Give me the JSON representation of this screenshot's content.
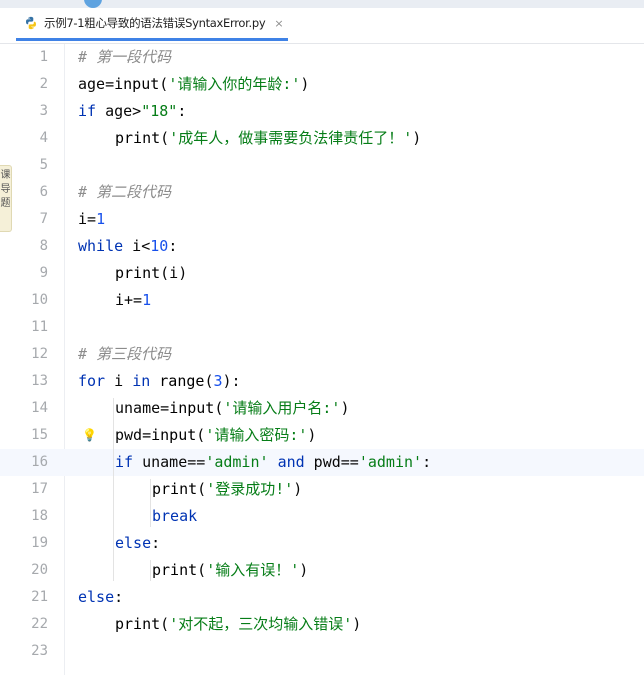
{
  "tab": {
    "title": "示例7-1粗心导致的语法错误SyntaxError.py",
    "close_glyph": "×",
    "icon": "python-file-icon"
  },
  "side_panel": {
    "chars": [
      "课",
      "导",
      "题"
    ]
  },
  "editor": {
    "current_line": 16,
    "lines": [
      {
        "n": 1,
        "indent": 0,
        "tokens": [
          {
            "t": "# 第一段代码",
            "c": "cmt"
          }
        ]
      },
      {
        "n": 2,
        "indent": 0,
        "tokens": [
          {
            "t": "age=",
            "c": ""
          },
          {
            "t": "input",
            "c": "fn"
          },
          {
            "t": "(",
            "c": ""
          },
          {
            "t": "'请输入你的年龄:'",
            "c": "str"
          },
          {
            "t": ")",
            "c": ""
          }
        ]
      },
      {
        "n": 3,
        "indent": 0,
        "tokens": [
          {
            "t": "if",
            "c": "kw"
          },
          {
            "t": " age>",
            "c": ""
          },
          {
            "t": "\"18\"",
            "c": "str"
          },
          {
            "t": ":",
            "c": ""
          }
        ]
      },
      {
        "n": 4,
        "indent": 1,
        "tokens": [
          {
            "t": "print",
            "c": "fn"
          },
          {
            "t": "(",
            "c": ""
          },
          {
            "t": "'成年人，做事需要负法律责任了！'",
            "c": "str"
          },
          {
            "t": ")",
            "c": ""
          }
        ]
      },
      {
        "n": 5,
        "indent": 0,
        "tokens": []
      },
      {
        "n": 6,
        "indent": 0,
        "tokens": [
          {
            "t": "# 第二段代码",
            "c": "cmt"
          }
        ]
      },
      {
        "n": 7,
        "indent": 0,
        "tokens": [
          {
            "t": "i=",
            "c": ""
          },
          {
            "t": "1",
            "c": "num"
          }
        ]
      },
      {
        "n": 8,
        "indent": 0,
        "tokens": [
          {
            "t": "while",
            "c": "kw"
          },
          {
            "t": " i<",
            "c": ""
          },
          {
            "t": "10",
            "c": "num"
          },
          {
            "t": ":",
            "c": ""
          }
        ]
      },
      {
        "n": 9,
        "indent": 1,
        "tokens": [
          {
            "t": "print",
            "c": "fn"
          },
          {
            "t": "(i)",
            "c": ""
          }
        ]
      },
      {
        "n": 10,
        "indent": 1,
        "tokens": [
          {
            "t": "i+=",
            "c": ""
          },
          {
            "t": "1",
            "c": "num"
          }
        ]
      },
      {
        "n": 11,
        "indent": 0,
        "tokens": []
      },
      {
        "n": 12,
        "indent": 0,
        "tokens": [
          {
            "t": "# 第三段代码",
            "c": "cmt"
          }
        ]
      },
      {
        "n": 13,
        "indent": 0,
        "tokens": [
          {
            "t": "for",
            "c": "kw"
          },
          {
            "t": " i ",
            "c": ""
          },
          {
            "t": "in",
            "c": "kw"
          },
          {
            "t": " ",
            "c": ""
          },
          {
            "t": "range",
            "c": "fn"
          },
          {
            "t": "(",
            "c": ""
          },
          {
            "t": "3",
            "c": "num"
          },
          {
            "t": "):",
            "c": ""
          }
        ]
      },
      {
        "n": 14,
        "indent": 1,
        "tokens": [
          {
            "t": "uname=",
            "c": ""
          },
          {
            "t": "input",
            "c": "fn"
          },
          {
            "t": "(",
            "c": ""
          },
          {
            "t": "'请输入用户名:'",
            "c": "str"
          },
          {
            "t": ")",
            "c": ""
          }
        ]
      },
      {
        "n": 15,
        "indent": 1,
        "bulb": true,
        "tokens": [
          {
            "t": "pwd=",
            "c": ""
          },
          {
            "t": "input",
            "c": "fn"
          },
          {
            "t": "(",
            "c": ""
          },
          {
            "t": "'请输入密码:'",
            "c": "str"
          },
          {
            "t": ")",
            "c": ""
          }
        ]
      },
      {
        "n": 16,
        "indent": 1,
        "tokens": [
          {
            "t": "if",
            "c": "kw"
          },
          {
            "t": " uname==",
            "c": ""
          },
          {
            "t": "'admin'",
            "c": "str"
          },
          {
            "t": " ",
            "c": ""
          },
          {
            "t": "and",
            "c": "kw"
          },
          {
            "t": " pwd==",
            "c": ""
          },
          {
            "t": "'admin'",
            "c": "str"
          },
          {
            "t": ":",
            "c": ""
          }
        ]
      },
      {
        "n": 17,
        "indent": 2,
        "tokens": [
          {
            "t": "print",
            "c": "fn"
          },
          {
            "t": "(",
            "c": ""
          },
          {
            "t": "'登录成功!'",
            "c": "str"
          },
          {
            "t": ")",
            "c": ""
          }
        ]
      },
      {
        "n": 18,
        "indent": 2,
        "tokens": [
          {
            "t": "break",
            "c": "kw"
          }
        ]
      },
      {
        "n": 19,
        "indent": 1,
        "tokens": [
          {
            "t": "else",
            "c": "kw"
          },
          {
            "t": ":",
            "c": ""
          }
        ]
      },
      {
        "n": 20,
        "indent": 2,
        "tokens": [
          {
            "t": "print",
            "c": "fn"
          },
          {
            "t": "(",
            "c": ""
          },
          {
            "t": "'输入有误！'",
            "c": "str"
          },
          {
            "t": ")",
            "c": ""
          }
        ]
      },
      {
        "n": 21,
        "indent": 0,
        "tokens": [
          {
            "t": "else",
            "c": "kw"
          },
          {
            "t": ":",
            "c": ""
          }
        ]
      },
      {
        "n": 22,
        "indent": 1,
        "tokens": [
          {
            "t": "print",
            "c": "fn"
          },
          {
            "t": "(",
            "c": ""
          },
          {
            "t": "'对不起，三次均输入错误'",
            "c": "str"
          },
          {
            "t": ")",
            "c": ""
          }
        ]
      },
      {
        "n": 23,
        "indent": 0,
        "tokens": []
      }
    ]
  },
  "colors": {
    "keyword": "#0033b3",
    "number": "#1750eb",
    "string": "#067d17",
    "comment": "#8c8c8c",
    "tab_underline": "#3f82e6"
  }
}
